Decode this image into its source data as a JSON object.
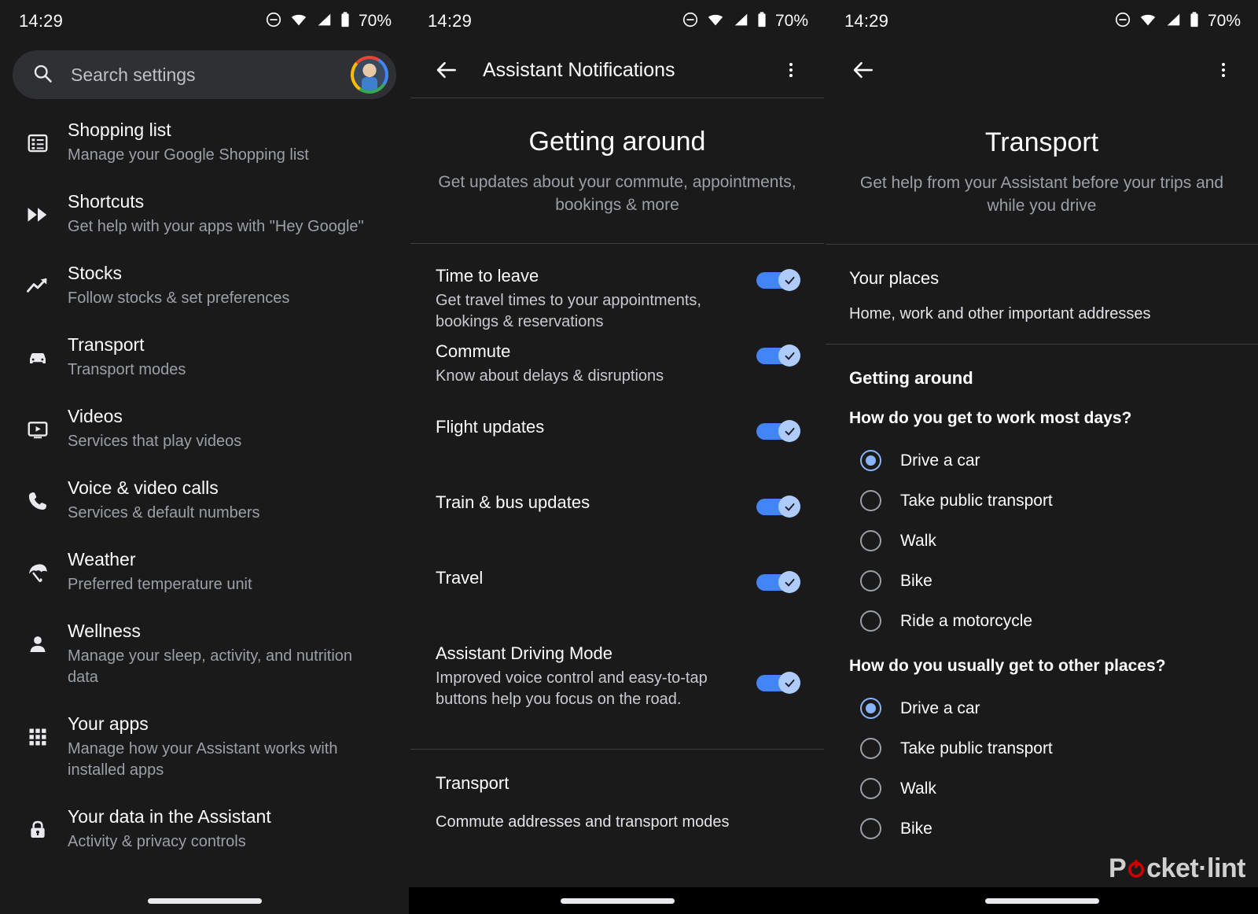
{
  "status_bar": {
    "time": "14:29",
    "battery_percent": "70%",
    "icons": [
      "dnd-icon",
      "wifi-icon",
      "signal-icon",
      "battery-icon"
    ]
  },
  "colors": {
    "background": "#1a1a1a",
    "toggle_track_on": "#4285f4",
    "toggle_thumb_on": "#aecbfa",
    "radio_selected": "#8ab4f8",
    "divider": "#3c4043",
    "search_field": "#2f3033",
    "text_primary": "#ffffff",
    "text_secondary": "#9aa0a6",
    "watermark_accent": "#cc0000"
  },
  "panel_left": {
    "search": {
      "placeholder": "Search settings",
      "icon": "search-icon",
      "avatar": "account-avatar"
    },
    "items": [
      {
        "icon": "list-icon",
        "title": "Shopping list",
        "subtitle": "Manage your Google Shopping list"
      },
      {
        "icon": "fastforward-icon",
        "title": "Shortcuts",
        "subtitle": "Get help with your apps with \"Hey Google\""
      },
      {
        "icon": "trendingup-icon",
        "title": "Stocks",
        "subtitle": "Follow stocks & set preferences"
      },
      {
        "icon": "car-icon",
        "title": "Transport",
        "subtitle": "Transport modes"
      },
      {
        "icon": "videoplayer-icon",
        "title": "Videos",
        "subtitle": "Services that play videos"
      },
      {
        "icon": "phone-icon",
        "title": "Voice & video calls",
        "subtitle": "Services & default numbers"
      },
      {
        "icon": "umbrella-icon",
        "title": "Weather",
        "subtitle": "Preferred temperature unit"
      },
      {
        "icon": "person-icon",
        "title": "Wellness",
        "subtitle": "Manage your sleep, activity, and nutrition data"
      },
      {
        "icon": "apps-grid-icon",
        "title": "Your apps",
        "subtitle": "Manage how your Assistant works with installed apps"
      },
      {
        "icon": "lock-icon",
        "title": "Your data in the Assistant",
        "subtitle": "Activity & privacy controls"
      }
    ]
  },
  "panel_mid": {
    "appbar": {
      "back_icon": "back-arrow-icon",
      "title": "Assistant Notifications",
      "overflow_icon": "more-vert-icon"
    },
    "hero": {
      "title": "Getting around",
      "subtitle": "Get updates about your commute, appointments, bookings & more"
    },
    "toggles": [
      {
        "title": "Time to leave",
        "subtitle": "Get travel times to your appointments, bookings & reservations",
        "on": true
      },
      {
        "title": "Commute",
        "subtitle": "Know about delays & disruptions",
        "on": true
      },
      {
        "title": "Flight updates",
        "subtitle": "",
        "on": true
      },
      {
        "title": "Train & bus updates",
        "subtitle": "",
        "on": true
      },
      {
        "title": "Travel",
        "subtitle": "",
        "on": true
      },
      {
        "title": "Assistant Driving Mode",
        "subtitle": "Improved voice control and easy-to-tap buttons help you focus on the road.",
        "on": true
      }
    ],
    "footer_section": {
      "title": "Transport",
      "subtitle": "Commute addresses and transport modes"
    }
  },
  "panel_right": {
    "appbar": {
      "back_icon": "back-arrow-icon",
      "title": "",
      "overflow_icon": "more-vert-icon"
    },
    "hero": {
      "title": "Transport",
      "subtitle": "Get help from your Assistant before your trips and while you drive"
    },
    "your_places": {
      "title": "Your places",
      "subtitle": "Home, work and other important addresses"
    },
    "getting_around_heading": "Getting around",
    "question_work": {
      "label": "How do you get to work most days?",
      "options": [
        {
          "label": "Drive a car",
          "selected": true
        },
        {
          "label": "Take public transport",
          "selected": false
        },
        {
          "label": "Walk",
          "selected": false
        },
        {
          "label": "Bike",
          "selected": false
        },
        {
          "label": "Ride a motorcycle",
          "selected": false
        }
      ]
    },
    "question_other": {
      "label": "How do you usually get to other places?",
      "options": [
        {
          "label": "Drive a car",
          "selected": true
        },
        {
          "label": "Take public transport",
          "selected": false
        },
        {
          "label": "Walk",
          "selected": false
        },
        {
          "label": "Bike",
          "selected": false
        }
      ]
    }
  },
  "watermark": {
    "text_before": "P",
    "text_after": "cket·lint"
  }
}
